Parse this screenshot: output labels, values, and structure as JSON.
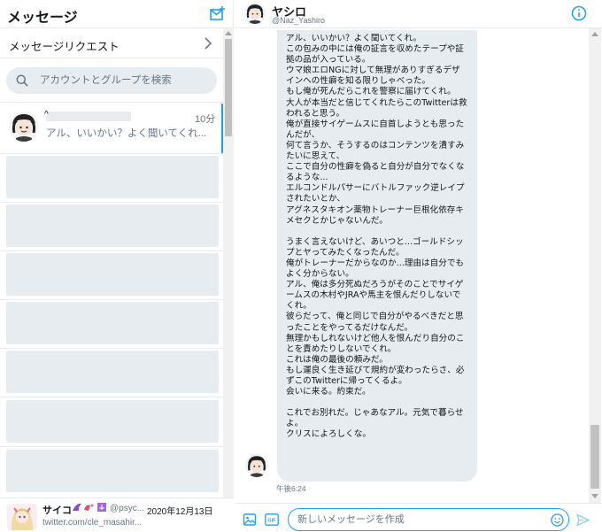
{
  "sidebar": {
    "title": "メッセージ",
    "requests_label": "メッセージリクエスト",
    "search_placeholder": "アカウントとグループを検索",
    "conversation": {
      "name_prefix": "^",
      "time": "10分",
      "preview": "アル、いいかい？よく聞いてくれ..."
    }
  },
  "bottom_tweet": {
    "name": "サイコ",
    "handle": "@psyc...",
    "date": "2020年12月13日",
    "link": "twitter.com/cle_masahir..."
  },
  "chat": {
    "name": "ヤシロ",
    "handle": "@Naz_Yashiro",
    "message": "アル、いいかい？よく聞いてくれ。\nこの包みの中には俺の証言を収めたテープや証拠の品が入っている。\nウマ娘エロNGに対して無理がありすぎるデザインへの性癖を知る限りしゃべった。\nもし俺が死んだらこれを警察に届けてくれ。\n大人が本当だと信じてくれたらこのTwitterは救われると思う。\n俺が直接サイゲームスに自首しようとも思ったんだが、\n何て言うか、そうするのはコンテンツを潰すみたいに思えて、\nここで自分の性癖を偽ると自分が自分でなくなるような...\nエルコンドルパサーにバトルファック逆レイプされたいとか、\nアグネスタキオン薬物トレーナー巨根化依存キメセクとかじゃないんだ。\n\nうまく言えないけど、あいつと...ゴールドシップとヤってみたくなったんだ。\n俺がトレーナーだからなのか...理由は自分でもよく分からない。\nアル、俺は多分死ぬだろうがそのことでサイゲームスの木村やJRAや馬主を恨んだりしないでくれ。\n彼らだって、俺と同じで自分がやるべきだと思ったことをやってるだけなんだ。\n無理かもしれないけど他人を恨んだり自分のことを責めたりしないでくれ。\nこれは俺の最後の頼みだ。\nもし運良く生き延びて規約が変わったらさ、必ずこのTwitterに帰ってくるよ。\n会いに来る。約束だ。\n\nこれでお別れだ。じゃあなアル。元気で暮らせよ。\nクリスによろしくな。",
    "time": "午後6:24",
    "compose_placeholder": "新しいメッセージを作成",
    "gif_label": "GIF"
  },
  "colors": {
    "accent": "#1da1f2",
    "bubble": "#e6ecf0",
    "border": "#e6ecf0",
    "placeholder_card": "#e6ecf0"
  },
  "icons": {
    "compose": "new-message-icon",
    "chevron": "chevron-right-icon",
    "search": "search-icon",
    "info": "info-icon",
    "media": "image-icon",
    "gif": "gif-icon",
    "emoji": "emoji-icon",
    "send": "send-icon"
  }
}
